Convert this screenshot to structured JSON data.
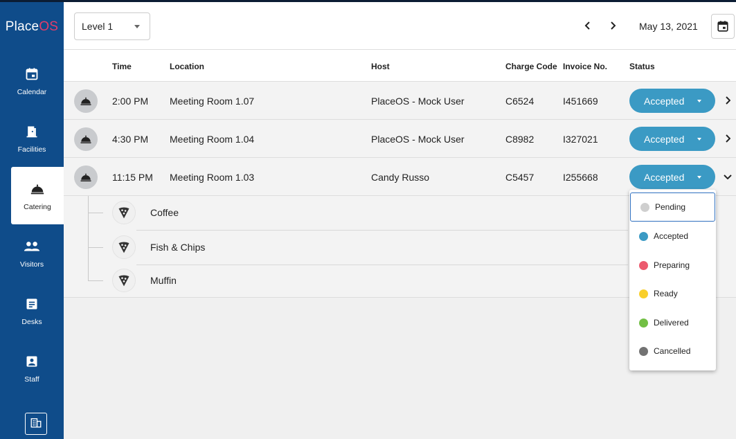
{
  "app": {
    "logo_main": "Place",
    "logo_accent": "OS"
  },
  "sidebar": {
    "items": [
      {
        "label": "Calendar",
        "icon": "calendar-icon"
      },
      {
        "label": "Facilities",
        "icon": "door-icon"
      },
      {
        "label": "Catering",
        "icon": "cloche-icon",
        "active": true
      },
      {
        "label": "Visitors",
        "icon": "people-icon"
      },
      {
        "label": "Desks",
        "icon": "desk-icon"
      },
      {
        "label": "Staff",
        "icon": "badge-icon"
      }
    ],
    "bottom_icon": "building-icon"
  },
  "topbar": {
    "level": "Level 1",
    "date": "May 13, 2021"
  },
  "table": {
    "headers": {
      "time": "Time",
      "location": "Location",
      "host": "Host",
      "charge_code": "Charge Code",
      "invoice": "Invoice No.",
      "status": "Status"
    },
    "rows": [
      {
        "time": "2:00 PM",
        "location": "Meeting Room 1.07",
        "host": "PlaceOS - Mock User",
        "charge_code": "C6524",
        "invoice": "I451669",
        "status": "Accepted"
      },
      {
        "time": "4:30 PM",
        "location": "Meeting Room 1.04",
        "host": "PlaceOS - Mock User",
        "charge_code": "C8982",
        "invoice": "I327021",
        "status": "Accepted"
      },
      {
        "time": "11:15 PM",
        "location": "Meeting Room 1.03",
        "host": "Candy Russo",
        "charge_code": "C5457",
        "invoice": "I255668",
        "status": "Accepted"
      }
    ],
    "expanded_items": [
      "Coffee",
      "Fish & Chips",
      "Muffin"
    ]
  },
  "status_menu": {
    "options": [
      {
        "label": "Pending",
        "color": "#cfcfcf"
      },
      {
        "label": "Accepted",
        "color": "#3b9ac4"
      },
      {
        "label": "Preparing",
        "color": "#ec5a6e"
      },
      {
        "label": "Ready",
        "color": "#f9cf2a"
      },
      {
        "label": "Delivered",
        "color": "#72bf44"
      },
      {
        "label": "Cancelled",
        "color": "#727272"
      }
    ]
  },
  "colors": {
    "sidebar": "#0f4c8a",
    "accent": "#3b9ac4",
    "brand_os": "#e23d6a"
  }
}
